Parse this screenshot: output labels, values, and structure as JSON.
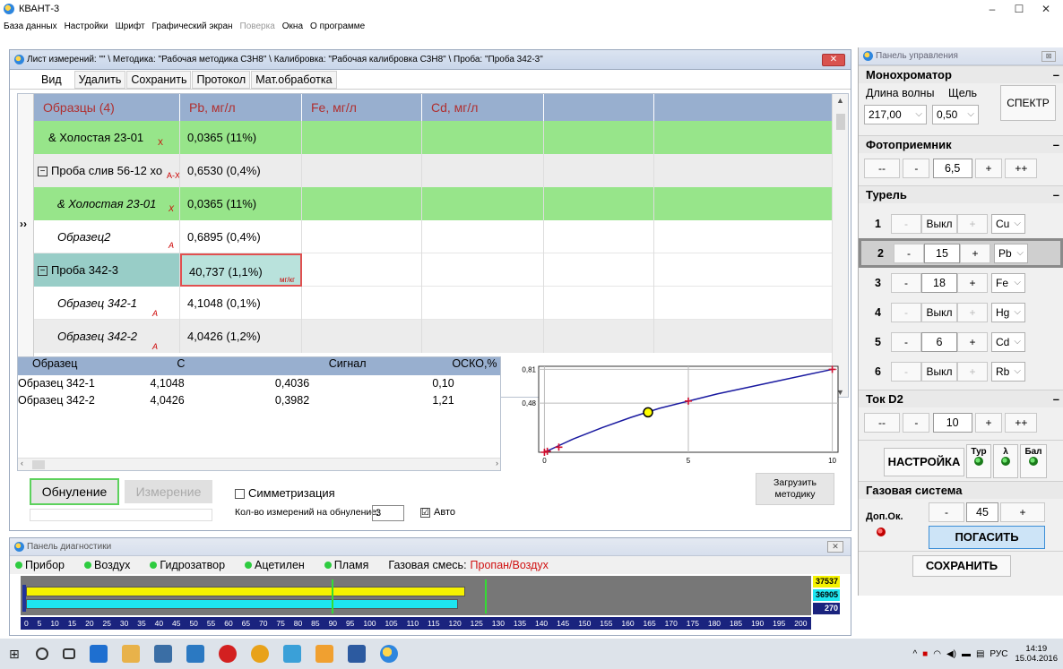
{
  "app": {
    "title": "КВАНТ-3",
    "min": "–",
    "max": "☐",
    "close": "✕"
  },
  "menu": [
    "База данных",
    "Настройки",
    "Шрифт",
    "Графический экран",
    "Поверка",
    "Окна",
    "О программе"
  ],
  "menu_disabled_index": 4,
  "mwin": {
    "title": "Лист измерений: \"\" \\ Методика: \"Рабочая методика C3H8\" \\ Калибровка: \"Рабочая калибровка C3H8\" \\ Проба: \"Проба 342-3\"",
    "close": "✕",
    "toolbar": {
      "view": "Вид",
      "delete": "Удалить",
      "save": "Сохранить",
      "protocol": "Протокол",
      "math": "Мат.обработка"
    }
  },
  "grid": {
    "headers": [
      "Образцы (4)",
      "Pb, мг/л",
      "Fe, мг/л",
      "Cd, мг/л",
      "",
      ""
    ],
    "rows": [
      {
        "name": "& Холостая 23-01",
        "tag": "X",
        "val": "0,0365 (11%)"
      },
      {
        "name": "Проба слив 56-12 хо",
        "tag": "A-X",
        "val": "0,6530 (0,4%)"
      },
      {
        "name": "& Холостая 23-01",
        "tag": "X",
        "val": "0,0365 (11%)"
      },
      {
        "name": "Образец2",
        "tag": "A",
        "val": "0,6895 (0,4%)"
      },
      {
        "name": "Проба 342-3",
        "tag": "",
        "val": "40,737 (1,1%)",
        "unit": "мг/кг"
      },
      {
        "name": "Образец 342-1",
        "tag": "A",
        "val": "4,1048 (0,1%)"
      },
      {
        "name": "Образец 342-2",
        "tag": "A",
        "val": "4,0426 (1,2%)"
      }
    ],
    "arrow": "››"
  },
  "lower": {
    "headers": [
      "Образец",
      "C",
      "Сигнал",
      "ОСКО,%"
    ],
    "rows": [
      [
        "Образец 342-1",
        "4,1048",
        "0,4036",
        "0,10"
      ],
      [
        "Образец 342-2",
        "4,0426",
        "0,3982",
        "1,21"
      ]
    ]
  },
  "chart_data": {
    "type": "scatter",
    "x_ticks": [
      "0",
      "5",
      "10"
    ],
    "y_ticks": [
      "0,81",
      "0,48"
    ],
    "xlim": [
      -0.2,
      10.2
    ],
    "ylim": [
      0.0,
      0.84
    ],
    "curve": {
      "x": [
        0,
        1,
        2,
        3,
        4,
        5,
        6,
        7,
        8,
        9,
        10
      ],
      "y": [
        0.0,
        0.13,
        0.24,
        0.34,
        0.43,
        0.5,
        0.57,
        0.63,
        0.69,
        0.75,
        0.81
      ]
    },
    "calibration_points": {
      "x": [
        0,
        0.1,
        0.5,
        5,
        10
      ],
      "y": [
        0,
        0.01,
        0.05,
        0.5,
        0.81
      ]
    },
    "current_point": {
      "x": 3.6,
      "y": 0.39
    },
    "colors": {
      "curve": "#1a1aa0",
      "points": "#d01030",
      "current": "#ffff00"
    }
  },
  "controls": {
    "zero": "Обнуление",
    "measure": "Измерение",
    "sym": "Симметризация",
    "count_label": "Кол-во измерений на обнуление:",
    "count": "3",
    "auto": "Авто",
    "load_line1": "Загрузить",
    "load_line2": "методику",
    "auto_check": "☑"
  },
  "diag": {
    "title": "Панель диагностики",
    "close": "✕",
    "status": [
      {
        "label": "Прибор"
      },
      {
        "label": "Воздух"
      },
      {
        "label": "Гидрозатвор"
      },
      {
        "label": "Ацетилен"
      },
      {
        "label": "Пламя"
      }
    ],
    "gas_label": "Газовая смесь:",
    "gas_value": "Пропан/Воздух",
    "bar_values": [
      "37537",
      "36905",
      "270"
    ],
    "bar_yellow_fraction": 0.57,
    "bar_cyan_fraction": 0.56,
    "scale": [
      "0",
      "5",
      "10",
      "15",
      "20",
      "25",
      "30",
      "35",
      "40",
      "45",
      "50",
      "55",
      "60",
      "65",
      "70",
      "75",
      "80",
      "85",
      "90",
      "95",
      "100",
      "105",
      "110",
      "115",
      "120",
      "125",
      "130",
      "135",
      "140",
      "145",
      "150",
      "155",
      "160",
      "165",
      "170",
      "175",
      "180",
      "185",
      "190",
      "195",
      "200"
    ]
  },
  "panel": {
    "title": "Панель управления",
    "x": "⊠",
    "mono": {
      "head": "Монохроматор",
      "wl_label": "Длина волны",
      "slit_label": "Щель",
      "wl": "217,00",
      "slit": "0,50",
      "spectr": "СПЕКТР"
    },
    "photo": {
      "head": "Фотоприемник",
      "mm": "--",
      "m": "-",
      "val": "6,5",
      "p": "+",
      "pp": "++"
    },
    "turret": {
      "head": "Турель",
      "rows": [
        {
          "n": "1",
          "m": "-",
          "v": "Выкл",
          "p": "+",
          "el": "Cu"
        },
        {
          "n": "2",
          "m": "-",
          "v": "15",
          "p": "+",
          "el": "Pb"
        },
        {
          "n": "3",
          "m": "-",
          "v": "18",
          "p": "+",
          "el": "Fe"
        },
        {
          "n": "4",
          "m": "-",
          "v": "Выкл",
          "p": "+",
          "el": "Hg"
        },
        {
          "n": "5",
          "m": "-",
          "v": "6",
          "p": "+",
          "el": "Cd"
        },
        {
          "n": "6",
          "m": "-",
          "v": "Выкл",
          "p": "+",
          "el": "Rb"
        }
      ]
    },
    "d2": {
      "head": "Ток D2",
      "mm": "--",
      "m": "-",
      "val": "10",
      "p": "+",
      "pp": "++"
    },
    "setup": {
      "label": "НАСТРОЙКА",
      "tur": "Тур",
      "lam": "λ",
      "bal": "Бал"
    },
    "gas": {
      "head": "Газовая система",
      "dop": "Доп.Ок.",
      "m": "-",
      "val": "45",
      "p": "+",
      "off": "ПОГАСИТЬ"
    },
    "save": "СОХРАНИТЬ",
    "dash": "–"
  },
  "taskbar": {
    "time": "14:19",
    "date": "15.04.2016",
    "lang": "РУС"
  }
}
